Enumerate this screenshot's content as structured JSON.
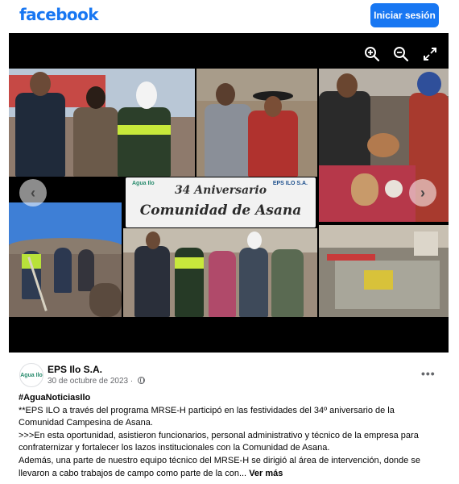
{
  "header": {
    "logo": "facebook",
    "login_label": "Iniciar sesión"
  },
  "viewer": {
    "tools": [
      "zoom-in-icon",
      "zoom-out-icon",
      "fullscreen-icon"
    ],
    "banner_line1": "34 Aniversario",
    "banner_line2": "Comunidad de Asana",
    "banner_logo_text": "Agua Ilo",
    "banner_brand": "EPS ILO S.A.",
    "prev_arrow": "‹",
    "next_arrow": "›"
  },
  "post": {
    "avatar_text": "Agua Ilo",
    "page_name": "EPS Ilo S.A.",
    "date": "30 de octubre de 2023 ·",
    "more_icon": "•••",
    "hashtag": "#AguaNoticiasIlo",
    "line1": "**EPS ILO a través del programa MRSE-H participó en las festividades del 34º aniversario de la Comunidad Campesina de Asana.",
    "line2": ">>>En esta oportunidad, asistieron funcionarios, personal administrativo y técnico de la empresa para confraternizar y fortalecer los lazos institucionales con la Comunidad de Asana.",
    "line3": "Además, una parte de nuestro equipo técnico del MRSE-H se dirigió al área de intervención, donde se llevaron a cabo trabajos de campo como parte de la con...",
    "see_more": "Ver más"
  },
  "colors": {
    "brand": "#1877f2",
    "viewer_bg": "#000000",
    "text_secondary": "#65676b"
  }
}
